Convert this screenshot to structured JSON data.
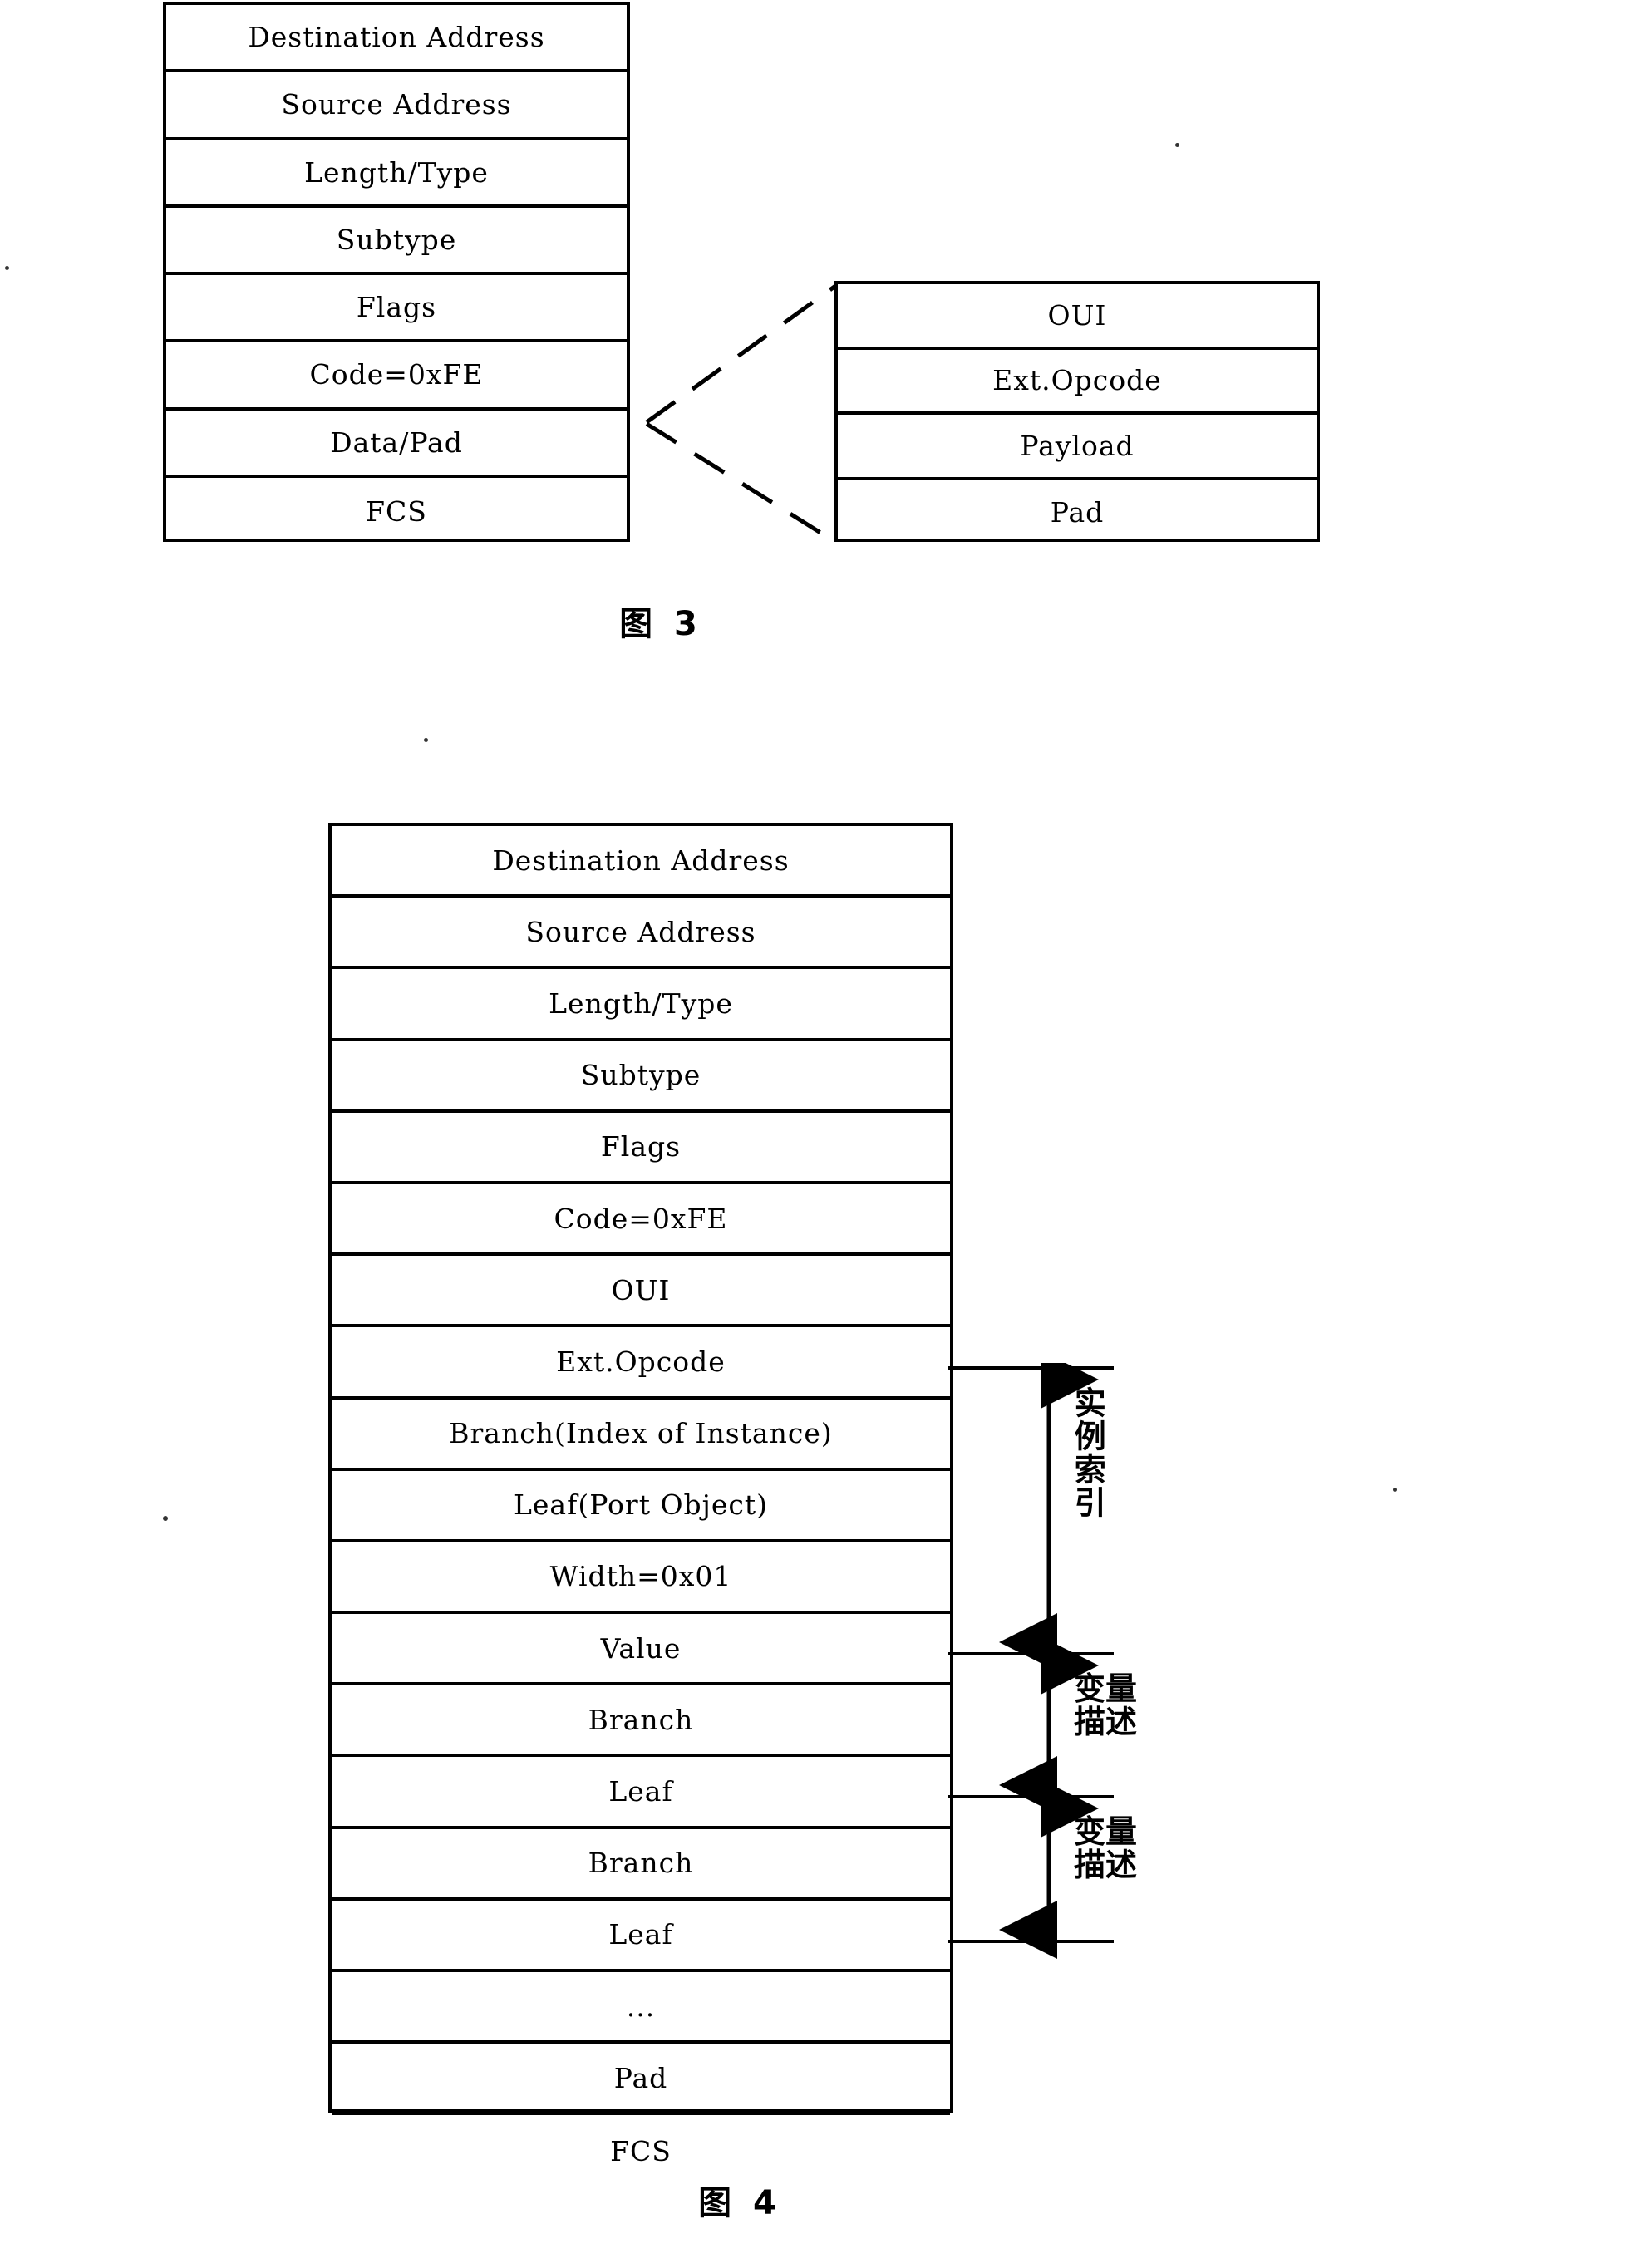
{
  "figure3": {
    "caption": "图 3",
    "left_frame": {
      "name": "ethernet-oam-frame",
      "rows": [
        "Destination Address",
        "Source Address",
        "Length/Type",
        "Subtype",
        "Flags",
        "Code=0xFE",
        "Data/Pad",
        "FCS"
      ]
    },
    "right_frame": {
      "name": "data-pad-expansion",
      "rows": [
        "OUI",
        "Ext.Opcode",
        "Payload",
        "Pad"
      ]
    }
  },
  "figure4": {
    "caption": "图 4",
    "frame": {
      "name": "oam-variable-frame",
      "rows": [
        "Destination Address",
        "Source Address",
        "Length/Type",
        "Subtype",
        "Flags",
        "Code=0xFE",
        "OUI",
        "Ext.Opcode",
        "Branch(Index of Instance)",
        "Leaf(Port Object)",
        "Width=0x01",
        "Value",
        "Branch",
        "Leaf",
        "Branch",
        "Leaf",
        "...",
        "Pad",
        "FCS"
      ]
    },
    "annotations": [
      {
        "name": "instance-index",
        "label": "实例索引",
        "orientation": "vertical"
      },
      {
        "name": "variable-description-1",
        "label": "变量描述",
        "orientation": "grid"
      },
      {
        "name": "variable-description-2",
        "label": "变量描述",
        "orientation": "grid"
      }
    ]
  },
  "colors": {
    "ink": "#000000",
    "paper": "#ffffff"
  }
}
